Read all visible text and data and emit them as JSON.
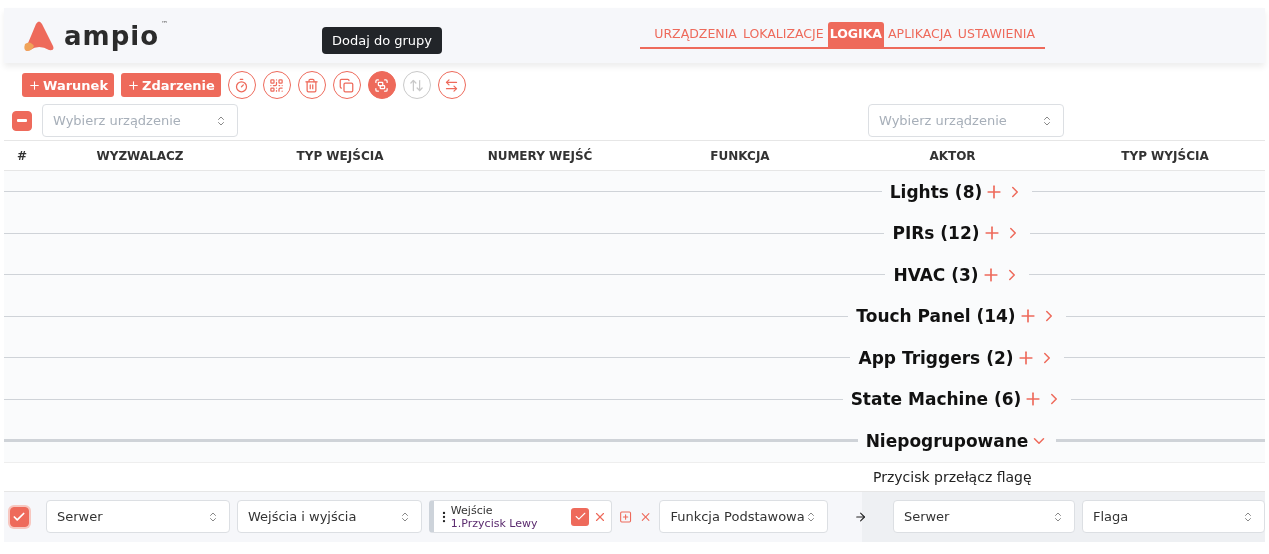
{
  "logo": {
    "text": "ampio",
    "trademark": "™"
  },
  "nav": [
    {
      "label": "URZĄDZENIA",
      "selected": false
    },
    {
      "label": "LOKALIZACJE",
      "selected": false
    },
    {
      "label": "LOGIKA",
      "selected": true
    },
    {
      "label": "APLIKACJA",
      "selected": false
    },
    {
      "label": "USTAWIENIA",
      "selected": false
    }
  ],
  "toolbar": {
    "buttons": [
      {
        "label": "Warunek"
      },
      {
        "label": "Zdarzenie"
      }
    ],
    "icons": [
      {
        "kind": "timer",
        "selected": false,
        "disabled": false
      },
      {
        "kind": "qr",
        "selected": false,
        "disabled": false
      },
      {
        "kind": "trash",
        "selected": false,
        "disabled": false
      },
      {
        "kind": "copy",
        "selected": false,
        "disabled": false
      },
      {
        "kind": "group",
        "selected": true,
        "disabled": false
      },
      {
        "kind": "sort",
        "selected": false,
        "disabled": true
      },
      {
        "kind": "swap",
        "selected": false,
        "disabled": false
      }
    ],
    "tooltip": "Dodaj do grupy"
  },
  "filters": {
    "indeterminate": true,
    "left": {
      "placeholder": "Wybierz urządzenie"
    },
    "right": {
      "placeholder": "Wybierz urządzenie"
    }
  },
  "columns": [
    "#",
    "WYZWALACZ",
    "TYP WEJŚCIA",
    "NUMERY WEJŚĆ",
    "FUNKCJA",
    "AKTOR",
    "TYP WYJŚCIA"
  ],
  "groups": [
    {
      "label": "Lights (8)",
      "expanded": false
    },
    {
      "label": "PIRs (12)",
      "expanded": false
    },
    {
      "label": "HVAC (3)",
      "expanded": false
    },
    {
      "label": "Touch Panel (14)",
      "expanded": false
    },
    {
      "label": "App Triggers (2)",
      "expanded": false
    },
    {
      "label": "State Machine (6)",
      "expanded": false
    },
    {
      "label": "Niepogrupowane",
      "expanded": true
    }
  ],
  "rule": {
    "title": "Przycisk przełącz flagę",
    "checked": true,
    "trigger": "Serwer",
    "input_type": "Wejścia i wyjścia",
    "input": {
      "label": "Wejście",
      "value": "1.Przycisk Lewy",
      "confirmed": true
    },
    "function": "Funkcja Podstawowa",
    "actor": "Serwer",
    "output_type": "Flaga"
  }
}
